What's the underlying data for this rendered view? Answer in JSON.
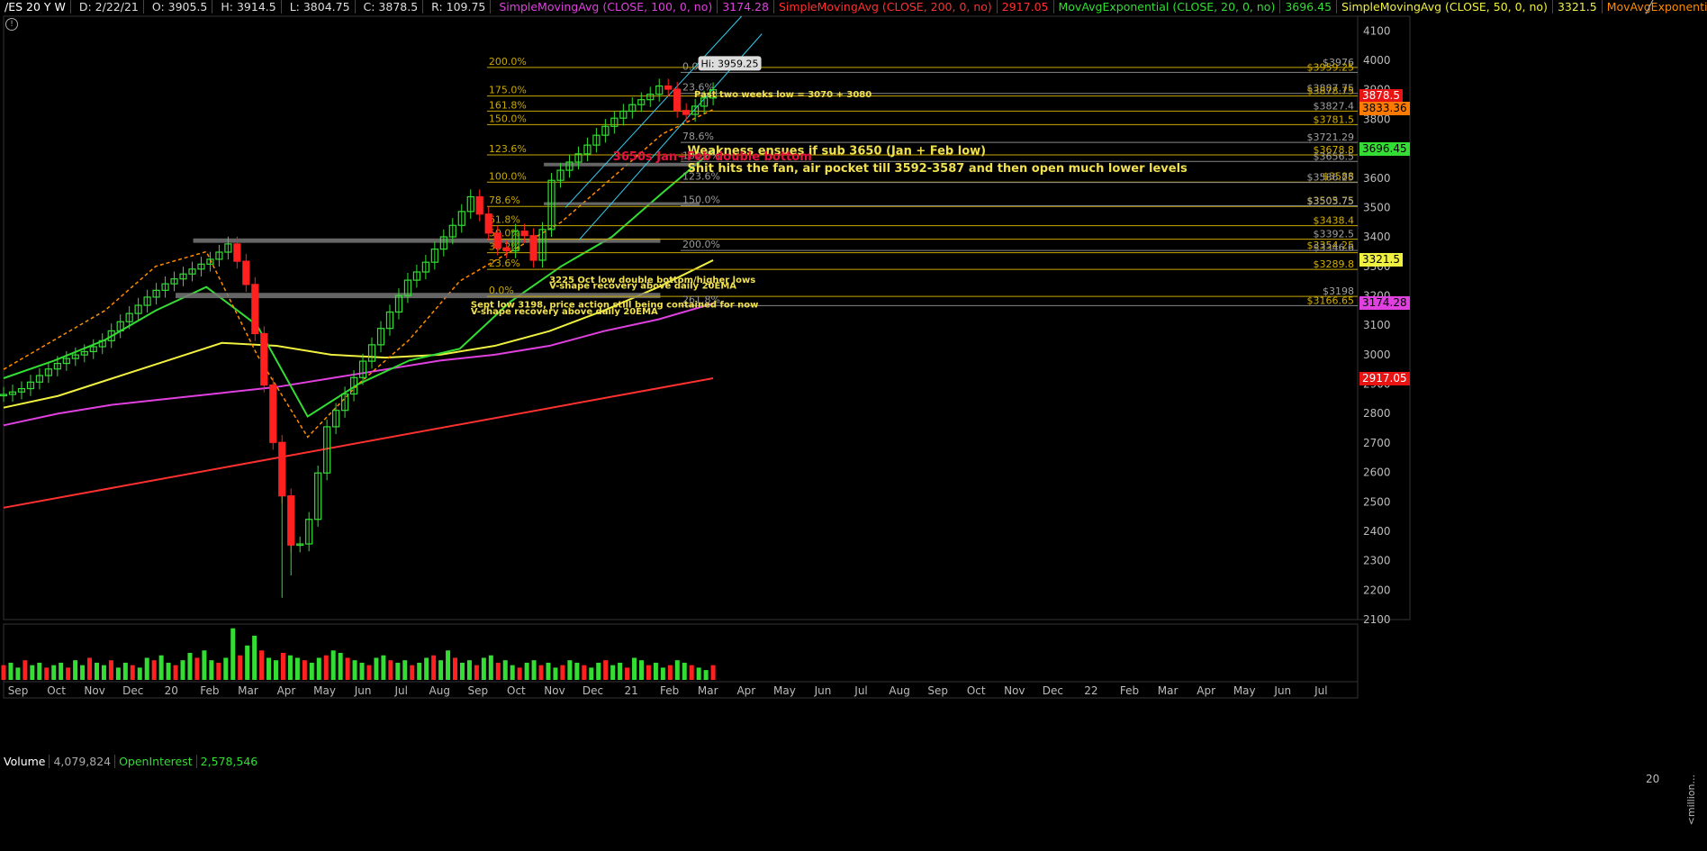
{
  "header": {
    "symbol": "/ES 20 Y W",
    "date": "D: 2/22/21",
    "open": "O: 3905.5",
    "high": "H: 3914.5",
    "low": "L: 3804.75",
    "close": "C: 3878.5",
    "range": "R: 109.75",
    "studies": [
      {
        "name": "SimpleMovingAvg (CLOSE, 100, 0, no)",
        "value": "3174.28",
        "color": "#e040e0"
      },
      {
        "name": "SimpleMovingAvg (CLOSE, 200, 0, no)",
        "value": "2917.05",
        "color": "#ff3030"
      },
      {
        "name": "MovAvgExponential (CLOSE, 20, 0, no)",
        "value": "3696.45",
        "color": "#33dd33"
      },
      {
        "name": "SimpleMovingAvg (CLOSE, 50, 0, no)",
        "value": "3321.5",
        "color": "#f0f040"
      },
      {
        "name": "MovAvgExponential (CLOSE, 8, 0, no)",
        "value": "3833.36",
        "color": "#ff8c00"
      }
    ],
    "more": "..."
  },
  "volume_panel": {
    "label": "Volume",
    "volume": "4,079,824",
    "oi_label": "OpenInterest",
    "oi": "2,578,546",
    "axis_top": "20",
    "axis_unit": "<million..."
  },
  "chart_data": {
    "type": "candlestick",
    "colors": {
      "up": "#33dd33",
      "down": "#ff2020",
      "sma100": "#e040e0",
      "sma200": "#ff3030",
      "ema20": "#33dd33",
      "sma50": "#f0f040",
      "ema8": "#ff8c00",
      "fib": "#c8a800"
    },
    "y_ticks": [
      2100,
      2200,
      2300,
      2400,
      2500,
      2600,
      2700,
      2800,
      2900,
      3000,
      3100,
      3200,
      3300,
      3400,
      3500,
      3600,
      3700,
      3800,
      3900,
      4000,
      4100
    ],
    "ylim": [
      2100,
      4150
    ],
    "x_labels": [
      "Sep",
      "Oct",
      "Nov",
      "Dec",
      "20",
      "Feb",
      "Mar",
      "Apr",
      "May",
      "Jun",
      "Jul",
      "Aug",
      "Sep",
      "Oct",
      "Nov",
      "Dec",
      "21",
      "Feb",
      "Mar",
      "Apr",
      "May",
      "Jun",
      "Jul",
      "Aug",
      "Sep",
      "Oct",
      "Nov",
      "Dec",
      "22",
      "Feb",
      "Mar",
      "Apr",
      "May",
      "Jun",
      "Jul"
    ],
    "price_anchors": [
      2865,
      2880,
      2920,
      2960,
      2990,
      3010,
      3040,
      3100,
      3150,
      3200,
      3240,
      3270,
      3300,
      3330,
      3380,
      3250,
      2950,
      2600,
      2300,
      2450,
      2750,
      2850,
      2950,
      3050,
      3150,
      3250,
      3300,
      3380,
      3450,
      3540,
      3420,
      3330,
      3450,
      3300,
      3600,
      3650,
      3700,
      3760,
      3810,
      3850,
      3880,
      3930,
      3800,
      3850,
      3900
    ],
    "price_lows": {
      "17": 2174,
      "18": 2250
    },
    "price_highs": {
      "41": 3959.25
    },
    "sma200_range": [
      2480,
      2920
    ],
    "sma100": [
      2760,
      2800,
      2830,
      2850,
      2870,
      2890,
      2920,
      2950,
      2980,
      3000,
      3030,
      3080,
      3120,
      3174
    ],
    "sma50": [
      2820,
      2860,
      2920,
      2980,
      3040,
      3030,
      3000,
      2990,
      3000,
      3030,
      3080,
      3150,
      3230,
      3321
    ],
    "ema20": [
      2920,
      2980,
      3050,
      3150,
      3230,
      3100,
      2790,
      2900,
      2980,
      3020,
      3180,
      3300,
      3400,
      3550,
      3696
    ],
    "ema8": [
      2950,
      3050,
      3150,
      3300,
      3350,
      3000,
      2720,
      2900,
      3050,
      3250,
      3350,
      3450,
      3600,
      3750,
      3833
    ],
    "volume": [
      6,
      7,
      5,
      8,
      6,
      7,
      5,
      6,
      7,
      5,
      8,
      6,
      9,
      7,
      6,
      8,
      5,
      7,
      6,
      5,
      9,
      8,
      10,
      7,
      6,
      8,
      11,
      9,
      12,
      8,
      7,
      9,
      21,
      10,
      14,
      18,
      12,
      9,
      8,
      11,
      10,
      9,
      8,
      7,
      9,
      10,
      12,
      11,
      9,
      8,
      7,
      6,
      9,
      10,
      8,
      7,
      8,
      6,
      7,
      9,
      10,
      8,
      12,
      9,
      7,
      8,
      6,
      9,
      10,
      7,
      8,
      6,
      5,
      7,
      8,
      6,
      7,
      5,
      6,
      8,
      7,
      6,
      5,
      7,
      8,
      6,
      7,
      5,
      9,
      8,
      6,
      7,
      5,
      6,
      8,
      7,
      6,
      5,
      4,
      6
    ],
    "fib_left": [
      {
        "pct": "200.0%",
        "price": 3976
      },
      {
        "pct": "175.0%",
        "price": 3878.75
      },
      {
        "pct": "161.8%",
        "price": 3827.4
      },
      {
        "pct": "150.0%",
        "price": 3781.5
      },
      {
        "pct": "123.6%",
        "price": 3678.8
      },
      {
        "pct": "100.0%",
        "price": 3586.25
      },
      {
        "pct": "78.6%",
        "price": 3503.75
      },
      {
        "pct": "61.8%",
        "price": 3438.4
      },
      {
        "pct": "50.0%",
        "price": 3392.5
      },
      {
        "pct": "38.2%",
        "price": 3346.6
      },
      {
        "pct": "23.6%",
        "price": 3289.8
      },
      {
        "pct": "0.0%",
        "price": 3198
      }
    ],
    "fib_right": [
      {
        "pct": "0.0%",
        "price": 3959.25
      },
      {
        "pct": "23.6%",
        "price": 3887.75
      },
      {
        "pct": "78.6%",
        "price": 3721.29
      },
      {
        "pct": "100.0%",
        "price": 3656.5
      },
      {
        "pct": "123.6%",
        "price": 3585
      },
      {
        "pct": "150.0%",
        "price": 3505.75
      },
      {
        "pct": "200.0%",
        "price": 3354.25
      },
      {
        "pct": "261.8%",
        "price": 3166.65
      }
    ],
    "price_labels": [
      "$3976",
      "$3959.25",
      "$3887.75",
      "$3878.75",
      "$3827.4",
      "$3781.5",
      "$3721.29",
      "$3678.8",
      "$3656.5",
      "$3588",
      "$3586.25",
      "$3505.75",
      "$3503.75",
      "$3438.4",
      "$3392.5",
      "$3354.25",
      "$3346.6",
      "$3289.8",
      "$3198",
      "$3166.65"
    ],
    "price_label_values": [
      3976,
      3959.25,
      3887.75,
      3878.75,
      3827.4,
      3781.5,
      3721.29,
      3678.8,
      3656.5,
      3588,
      3586.25,
      3505.75,
      3503.75,
      3438.4,
      3392.5,
      3354.25,
      3346.6,
      3289.8,
      3198,
      3166.65
    ],
    "zones": [
      {
        "from": 3380,
        "to": 3395,
        "x0": 0.14,
        "x1": 0.485
      },
      {
        "from": 3192,
        "to": 3210,
        "x0": 0.127,
        "x1": 0.485
      },
      {
        "from": 3640,
        "to": 3652,
        "x0": 0.399,
        "x1": 0.514
      },
      {
        "from": 3508,
        "to": 3518,
        "x0": 0.399,
        "x1": 0.514
      }
    ],
    "hi_label": "Hi: 3959.25",
    "annotations": [
      {
        "text": "Past two weeks low = 3070 + 3080",
        "price": 3875,
        "x": 0.51,
        "color": "#f0e050",
        "size": 10
      },
      {
        "text": "Weakness ensues if sub 3650 (Jan + Feb low)",
        "price": 3680,
        "x": 0.505,
        "color": "#f0e050",
        "size": 13
      },
      {
        "text": "3650s Jan+Feb double bottom",
        "price": 3660,
        "x": 0.45,
        "color": "#e8123c",
        "size": 13
      },
      {
        "text": "Shit hits the fan, air pocket till 3592-3587 and then open much lower levels",
        "price": 3620,
        "x": 0.505,
        "color": "#f0e050",
        "size": 13
      },
      {
        "text": "3225 Oct low double bottom/higher lows",
        "price": 3245,
        "x": 0.403,
        "color": "#f0e050",
        "size": 10
      },
      {
        "text": "V-shape recovery above daily 20EMA",
        "price": 3225,
        "x": 0.403,
        "color": "#f0e050",
        "size": 10
      },
      {
        "text": "Sept low 3198, price action still being contained for now",
        "price": 3160,
        "x": 0.345,
        "color": "#f0e050",
        "size": 10
      },
      {
        "text": "V-shape recovery above daily 20EMA",
        "price": 3138,
        "x": 0.345,
        "color": "#f0e050",
        "size": 10
      }
    ],
    "axis_pills": [
      {
        "text": "3878.5",
        "price": 3878.5,
        "color": "#e81414",
        "fg": "#fff"
      },
      {
        "text": "3833.36",
        "price": 3833.36,
        "color": "#ff7a00",
        "fg": "#000"
      },
      {
        "text": "3696.45",
        "price": 3696.45,
        "color": "#33dd33",
        "fg": "#000"
      },
      {
        "text": "3321.5",
        "price": 3321.5,
        "color": "#f0f040",
        "fg": "#000"
      },
      {
        "text": "3174.28",
        "price": 3174.28,
        "color": "#e040e0",
        "fg": "#000"
      },
      {
        "text": "2917.05",
        "price": 2917.05,
        "color": "#e81414",
        "fg": "#fff"
      }
    ]
  }
}
